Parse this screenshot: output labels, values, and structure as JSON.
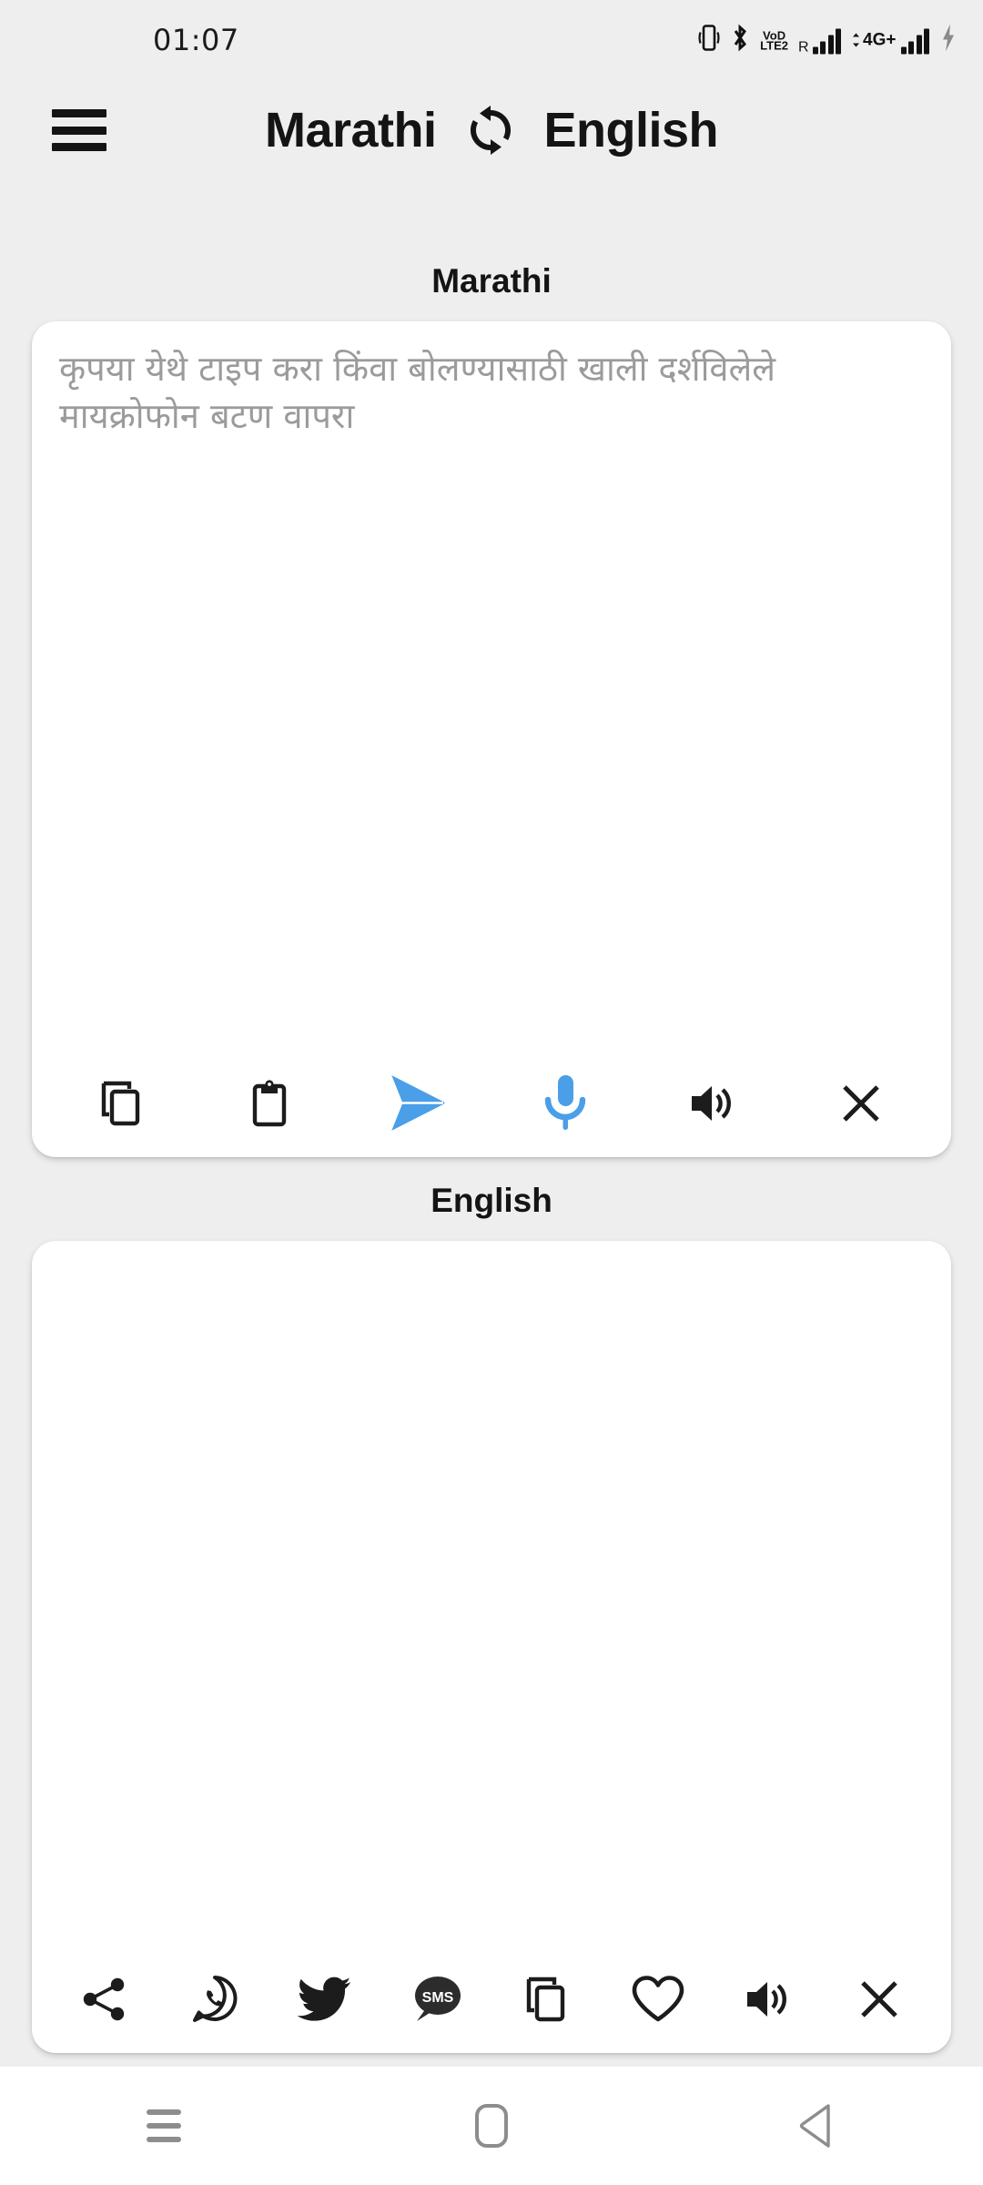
{
  "status_bar": {
    "clock": "01:07",
    "icons": [
      {
        "name": "vibrate-icon",
        "label": ""
      },
      {
        "name": "bluetooth-icon",
        "label": ""
      },
      {
        "name": "volte-icon",
        "label_top": "VoD",
        "label_bottom": "LTE2"
      },
      {
        "name": "signal-roaming-icon",
        "label": "R"
      },
      {
        "name": "signal-4g-plus-icon",
        "label": "4G+"
      },
      {
        "name": "charging-bolt-icon",
        "label": ""
      }
    ]
  },
  "header": {
    "menu_label": "menu",
    "source_language": "Marathi",
    "target_language": "English",
    "swap_label": "swap languages"
  },
  "source_panel": {
    "title": "Marathi",
    "placeholder": "कृपया येथे टाइप करा किंवा बोलण्यासाठी खाली दर्शविलेले मायक्रोफोन बटण वापरा",
    "value": "",
    "toolbar": [
      {
        "name": "copy-button",
        "icon": "copy-icon",
        "label": "Copy",
        "color": "#1c1c1c"
      },
      {
        "name": "paste-button",
        "icon": "clipboard-icon",
        "label": "Paste",
        "color": "#1c1c1c"
      },
      {
        "name": "translate-send-button",
        "icon": "send-icon",
        "label": "Translate",
        "color": "#4a9fe8"
      },
      {
        "name": "microphone-button",
        "icon": "microphone-icon",
        "label": "Speak",
        "color": "#4a9fe8"
      },
      {
        "name": "speak-aloud-button",
        "icon": "speaker-icon",
        "label": "Listen",
        "color": "#1c1c1c"
      },
      {
        "name": "clear-button",
        "icon": "close-icon",
        "label": "Clear",
        "color": "#1c1c1c"
      }
    ]
  },
  "target_panel": {
    "title": "English",
    "value": "",
    "toolbar": [
      {
        "name": "share-button",
        "icon": "share-icon",
        "label": "Share",
        "color": "#1c1c1c"
      },
      {
        "name": "whatsapp-button",
        "icon": "whatsapp-icon",
        "label": "WhatsApp",
        "color": "#1c1c1c"
      },
      {
        "name": "twitter-button",
        "icon": "twitter-icon",
        "label": "Twitter",
        "color": "#1c1c1c"
      },
      {
        "name": "sms-button",
        "icon": "sms-icon",
        "label": "SMS",
        "color": "#1c1c1c"
      },
      {
        "name": "copy-button",
        "icon": "copy-icon",
        "label": "Copy",
        "color": "#1c1c1c"
      },
      {
        "name": "favorite-button",
        "icon": "heart-icon",
        "label": "Favorite",
        "color": "#1c1c1c"
      },
      {
        "name": "speak-aloud-button",
        "icon": "speaker-icon",
        "label": "Listen",
        "color": "#1c1c1c"
      },
      {
        "name": "clear-button",
        "icon": "close-icon",
        "label": "Clear",
        "color": "#1c1c1c"
      }
    ]
  },
  "nav_bar": {
    "recents_label": "Recents",
    "home_label": "Home",
    "back_label": "Back"
  },
  "colors": {
    "background": "#eeeeee",
    "card": "#ffffff",
    "accent": "#4a9fe8",
    "text": "#141414",
    "placeholder": "#9b9b9b",
    "nav_icon": "#8d8d8d"
  }
}
